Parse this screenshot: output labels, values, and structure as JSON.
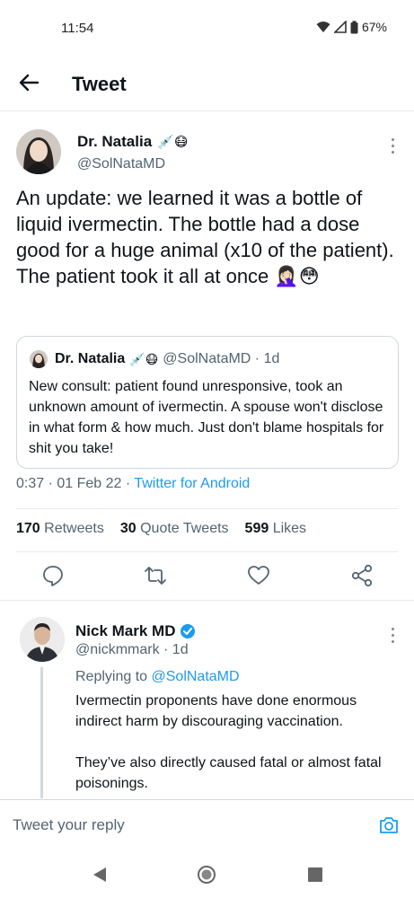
{
  "status_bar": {
    "time": "11:54",
    "battery": "67%"
  },
  "header": {
    "title": "Tweet"
  },
  "tweet": {
    "author_name": "Dr. Natalia",
    "author_emoji": "💉😷",
    "handle": "@SolNataMD",
    "text": "An update: we learned it was a bottle of liquid ivermectin. The bottle had a dose good for a huge animal (x10 of the patient). The patient took it all at once 🤦🏻‍♀️😳",
    "quoted": {
      "author_name": "Dr. Natalia",
      "author_emoji": "💉😷",
      "meta": "@SolNataMD · 1d",
      "text": "New consult: patient found unresponsive, took an unknown amount of ivermectin. A spouse won't disclose in what form & how much. Just don't blame hospitals for shit you take!"
    },
    "timestamp": "0:37 · 01 Feb 22 · ",
    "client": "Twitter for Android",
    "stats": {
      "retweets_count": "170",
      "retweets_label": "Retweets",
      "quotes_count": "30",
      "quotes_label": "Quote Tweets",
      "likes_count": "599",
      "likes_label": "Likes"
    }
  },
  "reply": {
    "author_name": "Nick Mark MD",
    "handle_meta": "@nickmmark · 1d",
    "replying_prefix": "Replying to ",
    "replying_to": "@SolNataMD",
    "paragraph_1": "Ivermectin proponents have done enormous indirect harm by discouraging vaccination.",
    "paragraph_2": "They’ve also directly caused fatal or almost fatal poisonings."
  },
  "composer": {
    "placeholder": "Tweet your reply"
  },
  "colors": {
    "accent": "#1d9bf0",
    "secondary_text": "#536471",
    "primary_text": "#0f1419",
    "verified": "#1d9bf0"
  },
  "icons": [
    "back-arrow-icon",
    "more-icon",
    "reply-icon",
    "retweet-icon",
    "like-icon",
    "share-icon",
    "verified-icon",
    "camera-icon",
    "nav-back-icon",
    "nav-home-icon",
    "nav-recents-icon"
  ]
}
